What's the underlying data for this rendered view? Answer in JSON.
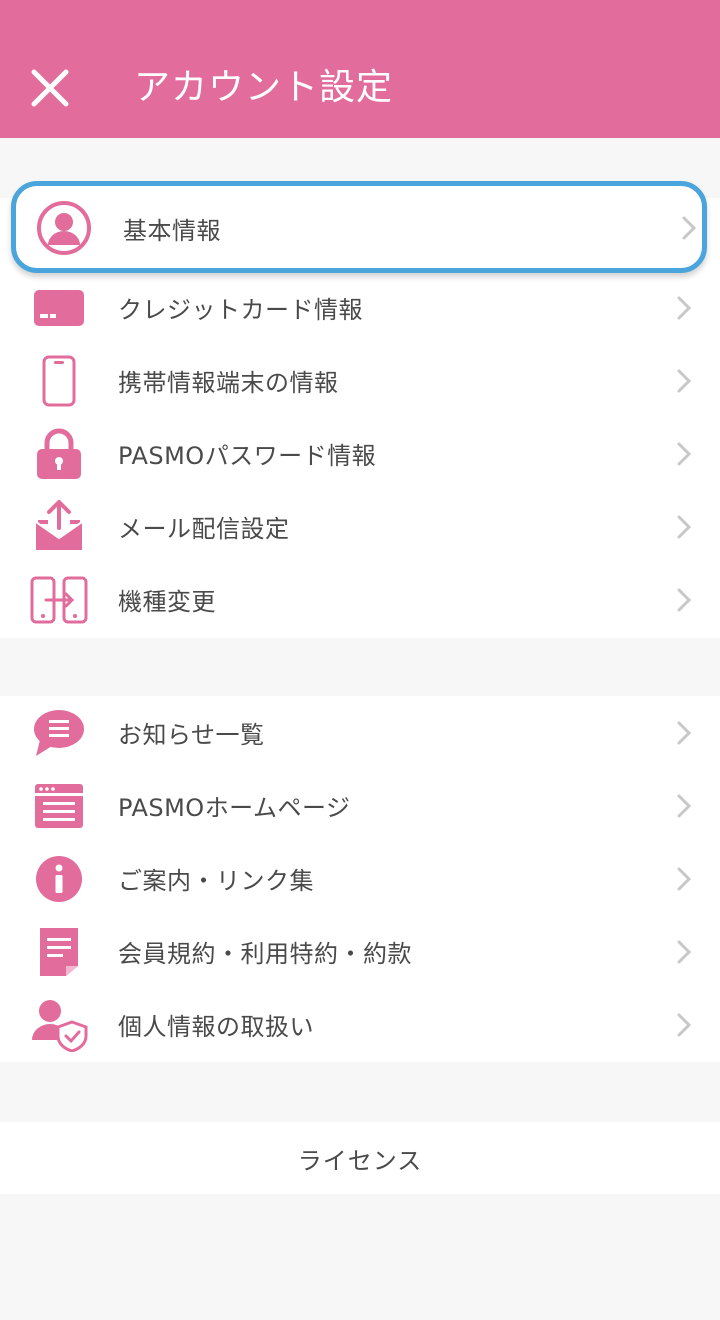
{
  "header": {
    "title": "アカウント設定",
    "close_icon": "close-icon"
  },
  "colors": {
    "accent": "#e26c9b",
    "highlight_border": "#4aa5dc",
    "chevron": "#c8c8c8"
  },
  "group1": {
    "items": [
      {
        "label": "基本情報",
        "icon": "user-circle-icon"
      },
      {
        "label": "クレジットカード情報",
        "icon": "credit-card-icon"
      },
      {
        "label": "携帯情報端末の情報",
        "icon": "smartphone-icon"
      },
      {
        "label": "PASMOパスワード情報",
        "icon": "lock-icon"
      },
      {
        "label": "メール配信設定",
        "icon": "mail-tray-icon"
      },
      {
        "label": "機種変更",
        "icon": "device-transfer-icon"
      }
    ]
  },
  "group2": {
    "items": [
      {
        "label": "お知らせ一覧",
        "icon": "message-list-icon"
      },
      {
        "label": "PASMOホームページ",
        "icon": "browser-page-icon"
      },
      {
        "label": "ご案内・リンク集",
        "icon": "info-icon"
      },
      {
        "label": "会員規約・利用特約・約款",
        "icon": "document-icon"
      },
      {
        "label": "個人情報の取扱い",
        "icon": "user-shield-icon"
      }
    ]
  },
  "footer": {
    "license_label": "ライセンス"
  }
}
